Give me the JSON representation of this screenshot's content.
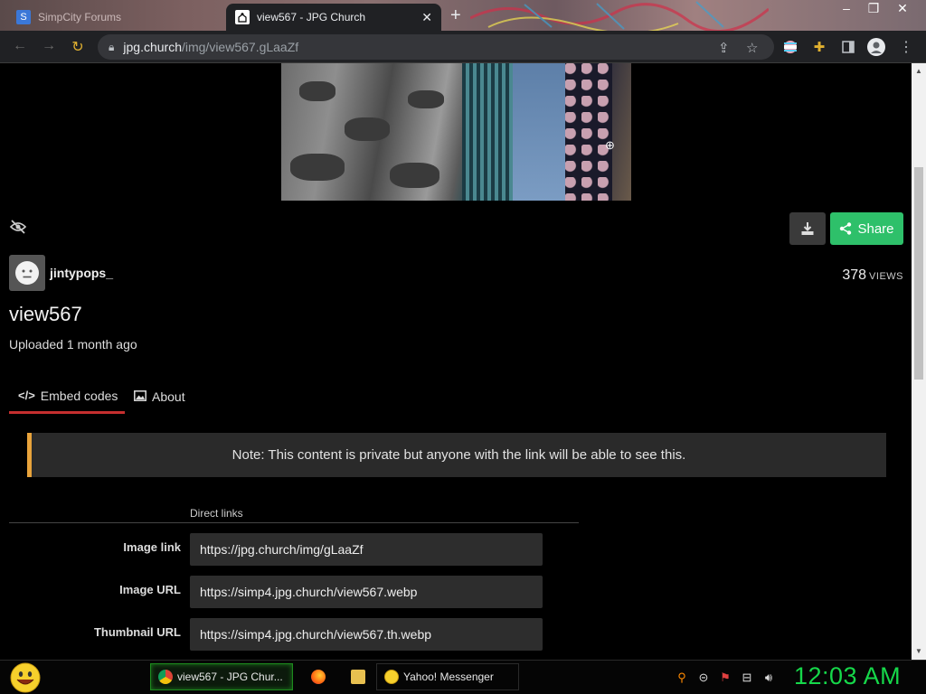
{
  "browser": {
    "tabs": [
      {
        "label": "SimpCity Forums"
      },
      {
        "label": "view567 - JPG Church"
      }
    ],
    "url_host": "jpg.church",
    "url_path": "/img/view567.gLaaZf"
  },
  "page": {
    "username": "jintypops_",
    "views_count": "378",
    "views_label": "VIEWS",
    "title": "view567",
    "uploaded": "Uploaded 1 month ago",
    "share_label": "Share",
    "tabs": [
      {
        "label": "Embed codes",
        "icon": "code-icon"
      },
      {
        "label": "About",
        "icon": "image-icon"
      }
    ],
    "note": "Note: This content is private but anyone with the link will be able to see this.",
    "direct_links_title": "Direct links",
    "links": [
      {
        "label": "Image link",
        "value": "https://jpg.church/img/gLaaZf"
      },
      {
        "label": "Image URL",
        "value": "https://simp4.jpg.church/view567.webp"
      },
      {
        "label": "Thumbnail URL",
        "value": "https://simp4.jpg.church/view567.th.webp"
      }
    ]
  },
  "taskbar": {
    "items": [
      {
        "label": "view567 - JPG Chur...",
        "icon": "chrome-icon"
      },
      {
        "label": "",
        "icon": "firefox-icon"
      },
      {
        "label": "",
        "icon": "explorer-icon"
      },
      {
        "label": "Yahoo! Messenger",
        "icon": "yahoo-messenger-icon"
      }
    ],
    "clock": "12:03 AM"
  },
  "colors": {
    "share_button": "#2ec06a",
    "note_accent": "#e8a33b",
    "tab_underline": "#c62f2f",
    "clock": "#16d84a"
  }
}
